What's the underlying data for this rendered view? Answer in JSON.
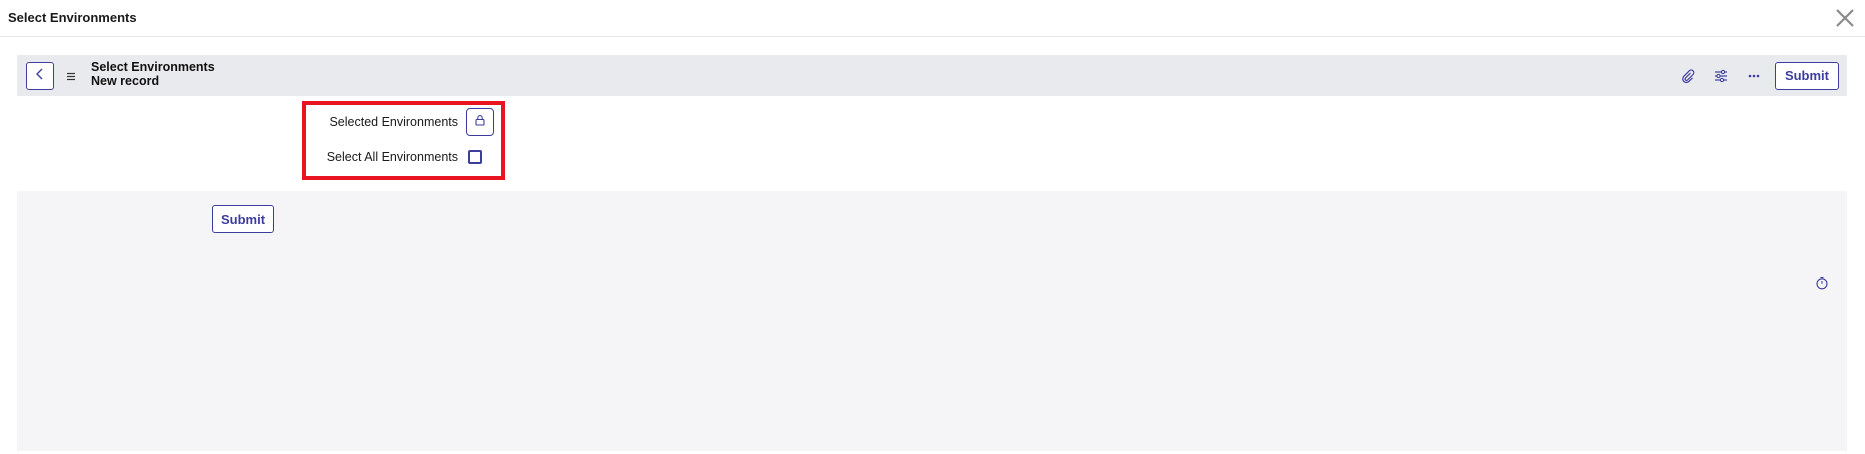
{
  "modal": {
    "title": "Select Environments",
    "close_icon": "close-icon"
  },
  "header": {
    "title": "Select Environments",
    "subtitle": "New record",
    "back_icon": "chevron-left-icon",
    "menu_icon": "hamburger-icon",
    "actions": {
      "attachment_icon": "paperclip-icon",
      "settings_icon": "sliders-icon",
      "more_icon": "more-icon",
      "submit_label": "Submit"
    }
  },
  "form": {
    "selected_environments_label": "Selected Environments",
    "selected_environments_icon": "lock-icon",
    "select_all_label": "Select All Environments",
    "select_all_checked": false
  },
  "footer": {
    "submit_label": "Submit",
    "timer_icon": "stopwatch-icon"
  },
  "colors": {
    "accent": "#3d3d9e",
    "highlight": "#e8141f",
    "header_bg": "#e9eaed",
    "lower_bg": "#f5f5f7"
  }
}
